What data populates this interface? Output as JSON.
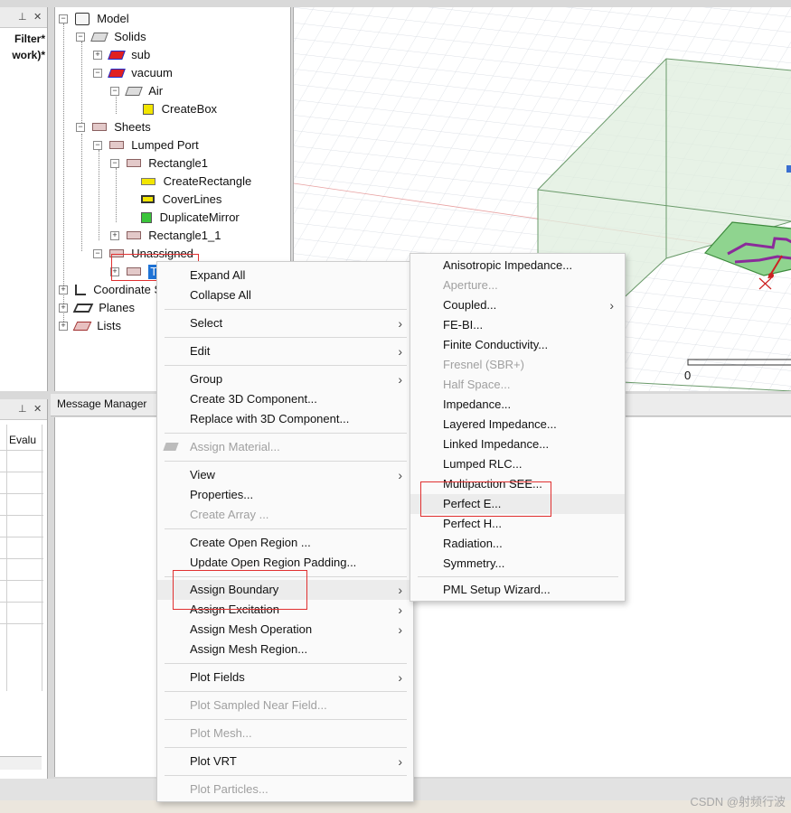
{
  "left_panel": {
    "items": [
      "Filter*",
      "work)*"
    ],
    "grid_header": "Evalu"
  },
  "tree": {
    "nodes": [
      {
        "label": "Model"
      },
      {
        "label": "Solids"
      },
      {
        "label": "sub"
      },
      {
        "label": "vacuum"
      },
      {
        "label": "Air"
      },
      {
        "label": "CreateBox"
      },
      {
        "label": "Sheets"
      },
      {
        "label": "Lumped Port"
      },
      {
        "label": "Rectangle1"
      },
      {
        "label": "CreateRectangle"
      },
      {
        "label": "CoverLines"
      },
      {
        "label": "DuplicateMirror"
      },
      {
        "label": "Rectangle1_1"
      },
      {
        "label": "Unassigned"
      },
      {
        "label": "Tra"
      },
      {
        "label": "Coordinate S"
      },
      {
        "label": "Planes"
      },
      {
        "label": "Lists"
      }
    ]
  },
  "view3d": {
    "scale_label": "0"
  },
  "message_manager": {
    "title": "Message Manager"
  },
  "context_menu": {
    "items": [
      {
        "label": "Expand All"
      },
      {
        "label": "Collapse All"
      },
      {
        "label": "Select"
      },
      {
        "label": "Edit"
      },
      {
        "label": "Group"
      },
      {
        "label": "Create 3D Component..."
      },
      {
        "label": "Replace with 3D Component..."
      },
      {
        "label": "Assign Material..."
      },
      {
        "label": "View"
      },
      {
        "label": "Properties..."
      },
      {
        "label": "Create Array ..."
      },
      {
        "label": "Create Open Region ..."
      },
      {
        "label": "Update Open Region Padding..."
      },
      {
        "label": "Assign Boundary"
      },
      {
        "label": "Assign Excitation"
      },
      {
        "label": "Assign Mesh Operation"
      },
      {
        "label": "Assign Mesh Region..."
      },
      {
        "label": "Plot Fields"
      },
      {
        "label": "Plot Sampled Near Field..."
      },
      {
        "label": "Plot Mesh..."
      },
      {
        "label": "Plot VRT"
      },
      {
        "label": "Plot Particles..."
      }
    ]
  },
  "boundary_submenu": {
    "items": [
      {
        "label": "Anisotropic Impedance..."
      },
      {
        "label": "Aperture..."
      },
      {
        "label": "Coupled..."
      },
      {
        "label": "FE-BI..."
      },
      {
        "label": "Finite Conductivity..."
      },
      {
        "label": "Fresnel (SBR+)"
      },
      {
        "label": "Half Space..."
      },
      {
        "label": "Impedance..."
      },
      {
        "label": "Layered Impedance..."
      },
      {
        "label": "Linked Impedance..."
      },
      {
        "label": "Lumped RLC..."
      },
      {
        "label": "Multipaction SEE..."
      },
      {
        "label": "Perfect E..."
      },
      {
        "label": "Perfect H..."
      },
      {
        "label": "Radiation..."
      },
      {
        "label": "Symmetry..."
      },
      {
        "label": "PML Setup Wizard..."
      }
    ]
  },
  "watermark": "CSDN @射频行波",
  "colors": {
    "highlight_red": "#e03030",
    "selection_blue": "#1e73d6",
    "air_box_green": "#cfe6cf",
    "trace_purple": "#8a2b9a"
  }
}
